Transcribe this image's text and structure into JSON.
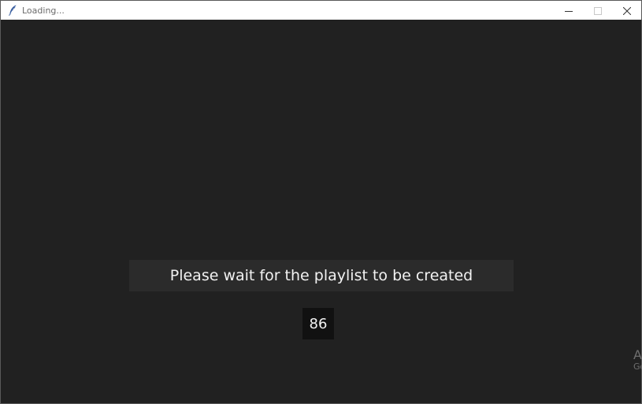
{
  "window": {
    "title": "Loading...",
    "app_icon": "feather-icon",
    "controls": [
      "minimize-icon",
      "maximize-icon",
      "close-icon"
    ]
  },
  "main": {
    "message": "Please wait for the playlist to be created",
    "counter": "86"
  },
  "watermark": {
    "line1": "A",
    "line2": "Go"
  },
  "colors": {
    "background": "#212121",
    "message_box": "#2b2b2b",
    "counter_box": "#111111",
    "text": "#f2f2f2"
  }
}
